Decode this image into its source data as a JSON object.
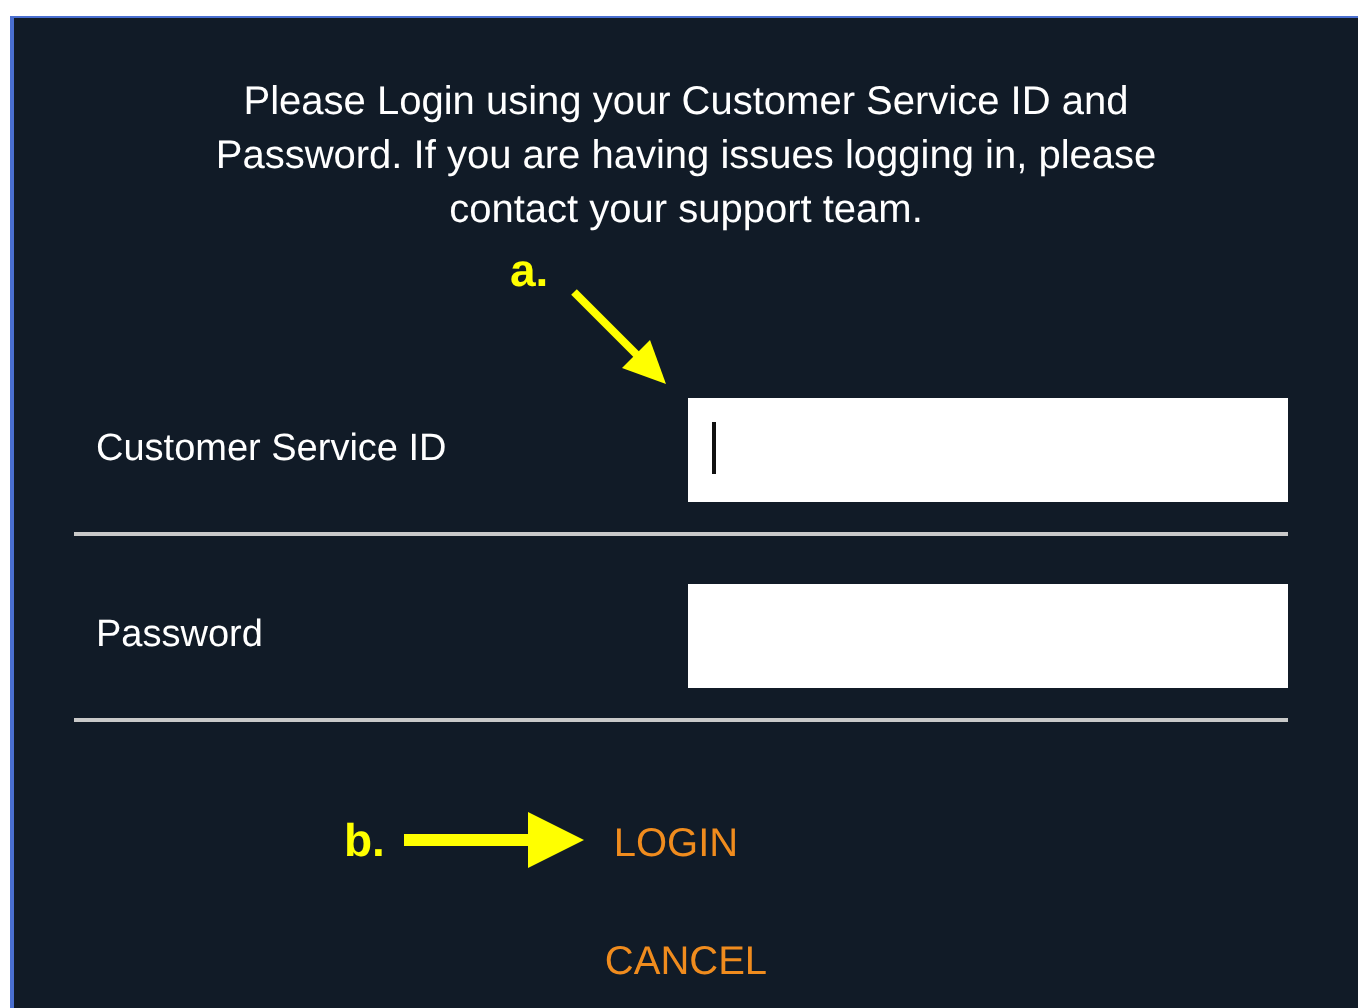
{
  "dialog": {
    "message": "Please Login using your Customer Service ID and Password. If you are having issues logging in, please contact your support team.",
    "fields": [
      {
        "label": "Customer Service ID",
        "focused": true
      },
      {
        "label": "Password",
        "focused": false
      }
    ],
    "buttons": [
      "LOGIN",
      "CANCEL"
    ]
  },
  "annotations": [
    {
      "label": "a."
    },
    {
      "label": "b."
    }
  ]
}
